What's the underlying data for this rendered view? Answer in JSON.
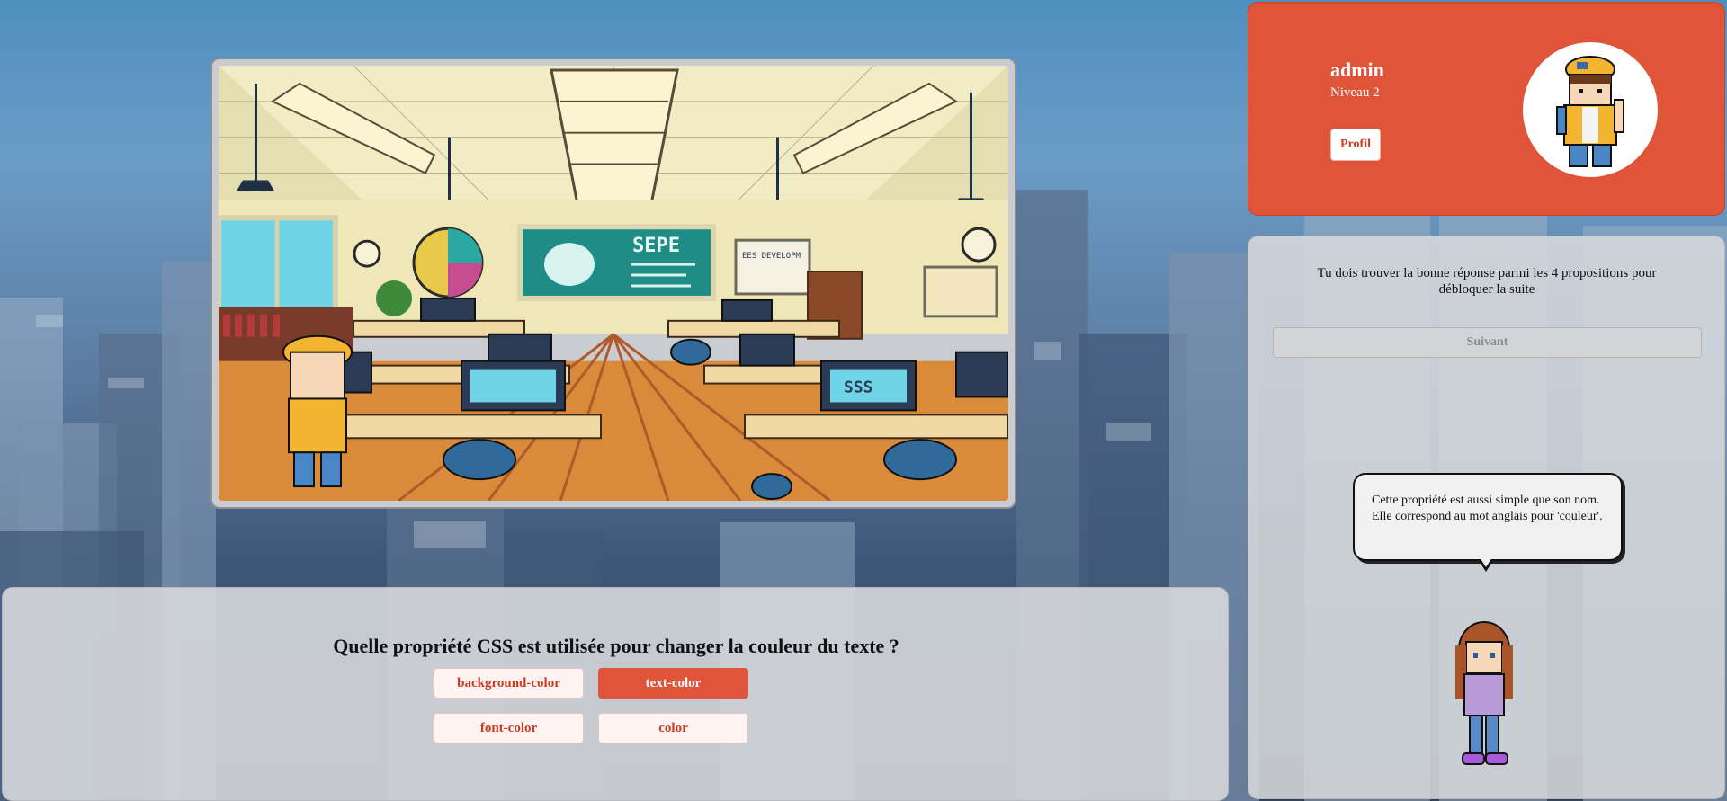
{
  "profile": {
    "username": "admin",
    "level": "Niveau 2",
    "profile_button": "Profil",
    "avatar_icon": "boy-character-avatar"
  },
  "side": {
    "instructions": "Tu dois trouver la bonne réponse parmi les 4 propositions pour débloquer la suite",
    "next_button": "Suivant",
    "hint": "Cette propriété est aussi simple que son nom. Elle correspond au mot anglais pour 'couleur'.",
    "guide_icon": "girl-guide-character"
  },
  "scene": {
    "board_label": "SEPE",
    "monitor_label": "SSS",
    "board2_label": "EES DEVELOPM"
  },
  "quiz": {
    "question": "Quelle propriété CSS est utilisée pour changer la couleur du texte ?",
    "answers": [
      "background-color",
      "text-color",
      "font-color",
      "color"
    ],
    "selected": "text-color"
  },
  "colors": {
    "accent": "#e0543a",
    "panel": "#d6d8dc"
  }
}
